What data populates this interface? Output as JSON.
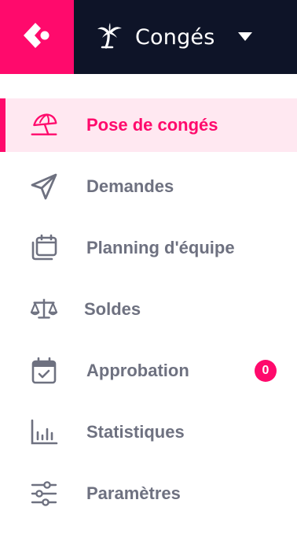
{
  "header": {
    "module_title": "Congés",
    "module_icon": "palm-tree-icon",
    "logo_icon": "app-logo-icon",
    "caret_icon": "caret-down-icon"
  },
  "colors": {
    "accent": "#ff0a6c",
    "header_dark": "#0e1428",
    "active_bg": "#ffe8f1",
    "text_muted": "#6e7180"
  },
  "nav": {
    "items": [
      {
        "label": "Pose de congés",
        "icon": "beach-umbrella-icon",
        "active": true
      },
      {
        "label": "Demandes",
        "icon": "paper-plane-icon"
      },
      {
        "label": "Planning d'équipe",
        "icon": "calendar-stack-icon"
      },
      {
        "label": "Soldes",
        "icon": "scales-icon"
      },
      {
        "label": "Approbation",
        "icon": "calendar-check-icon",
        "badge": "0"
      },
      {
        "label": "Statistiques",
        "icon": "bar-chart-icon"
      },
      {
        "label": "Paramètres",
        "icon": "sliders-icon"
      }
    ]
  }
}
